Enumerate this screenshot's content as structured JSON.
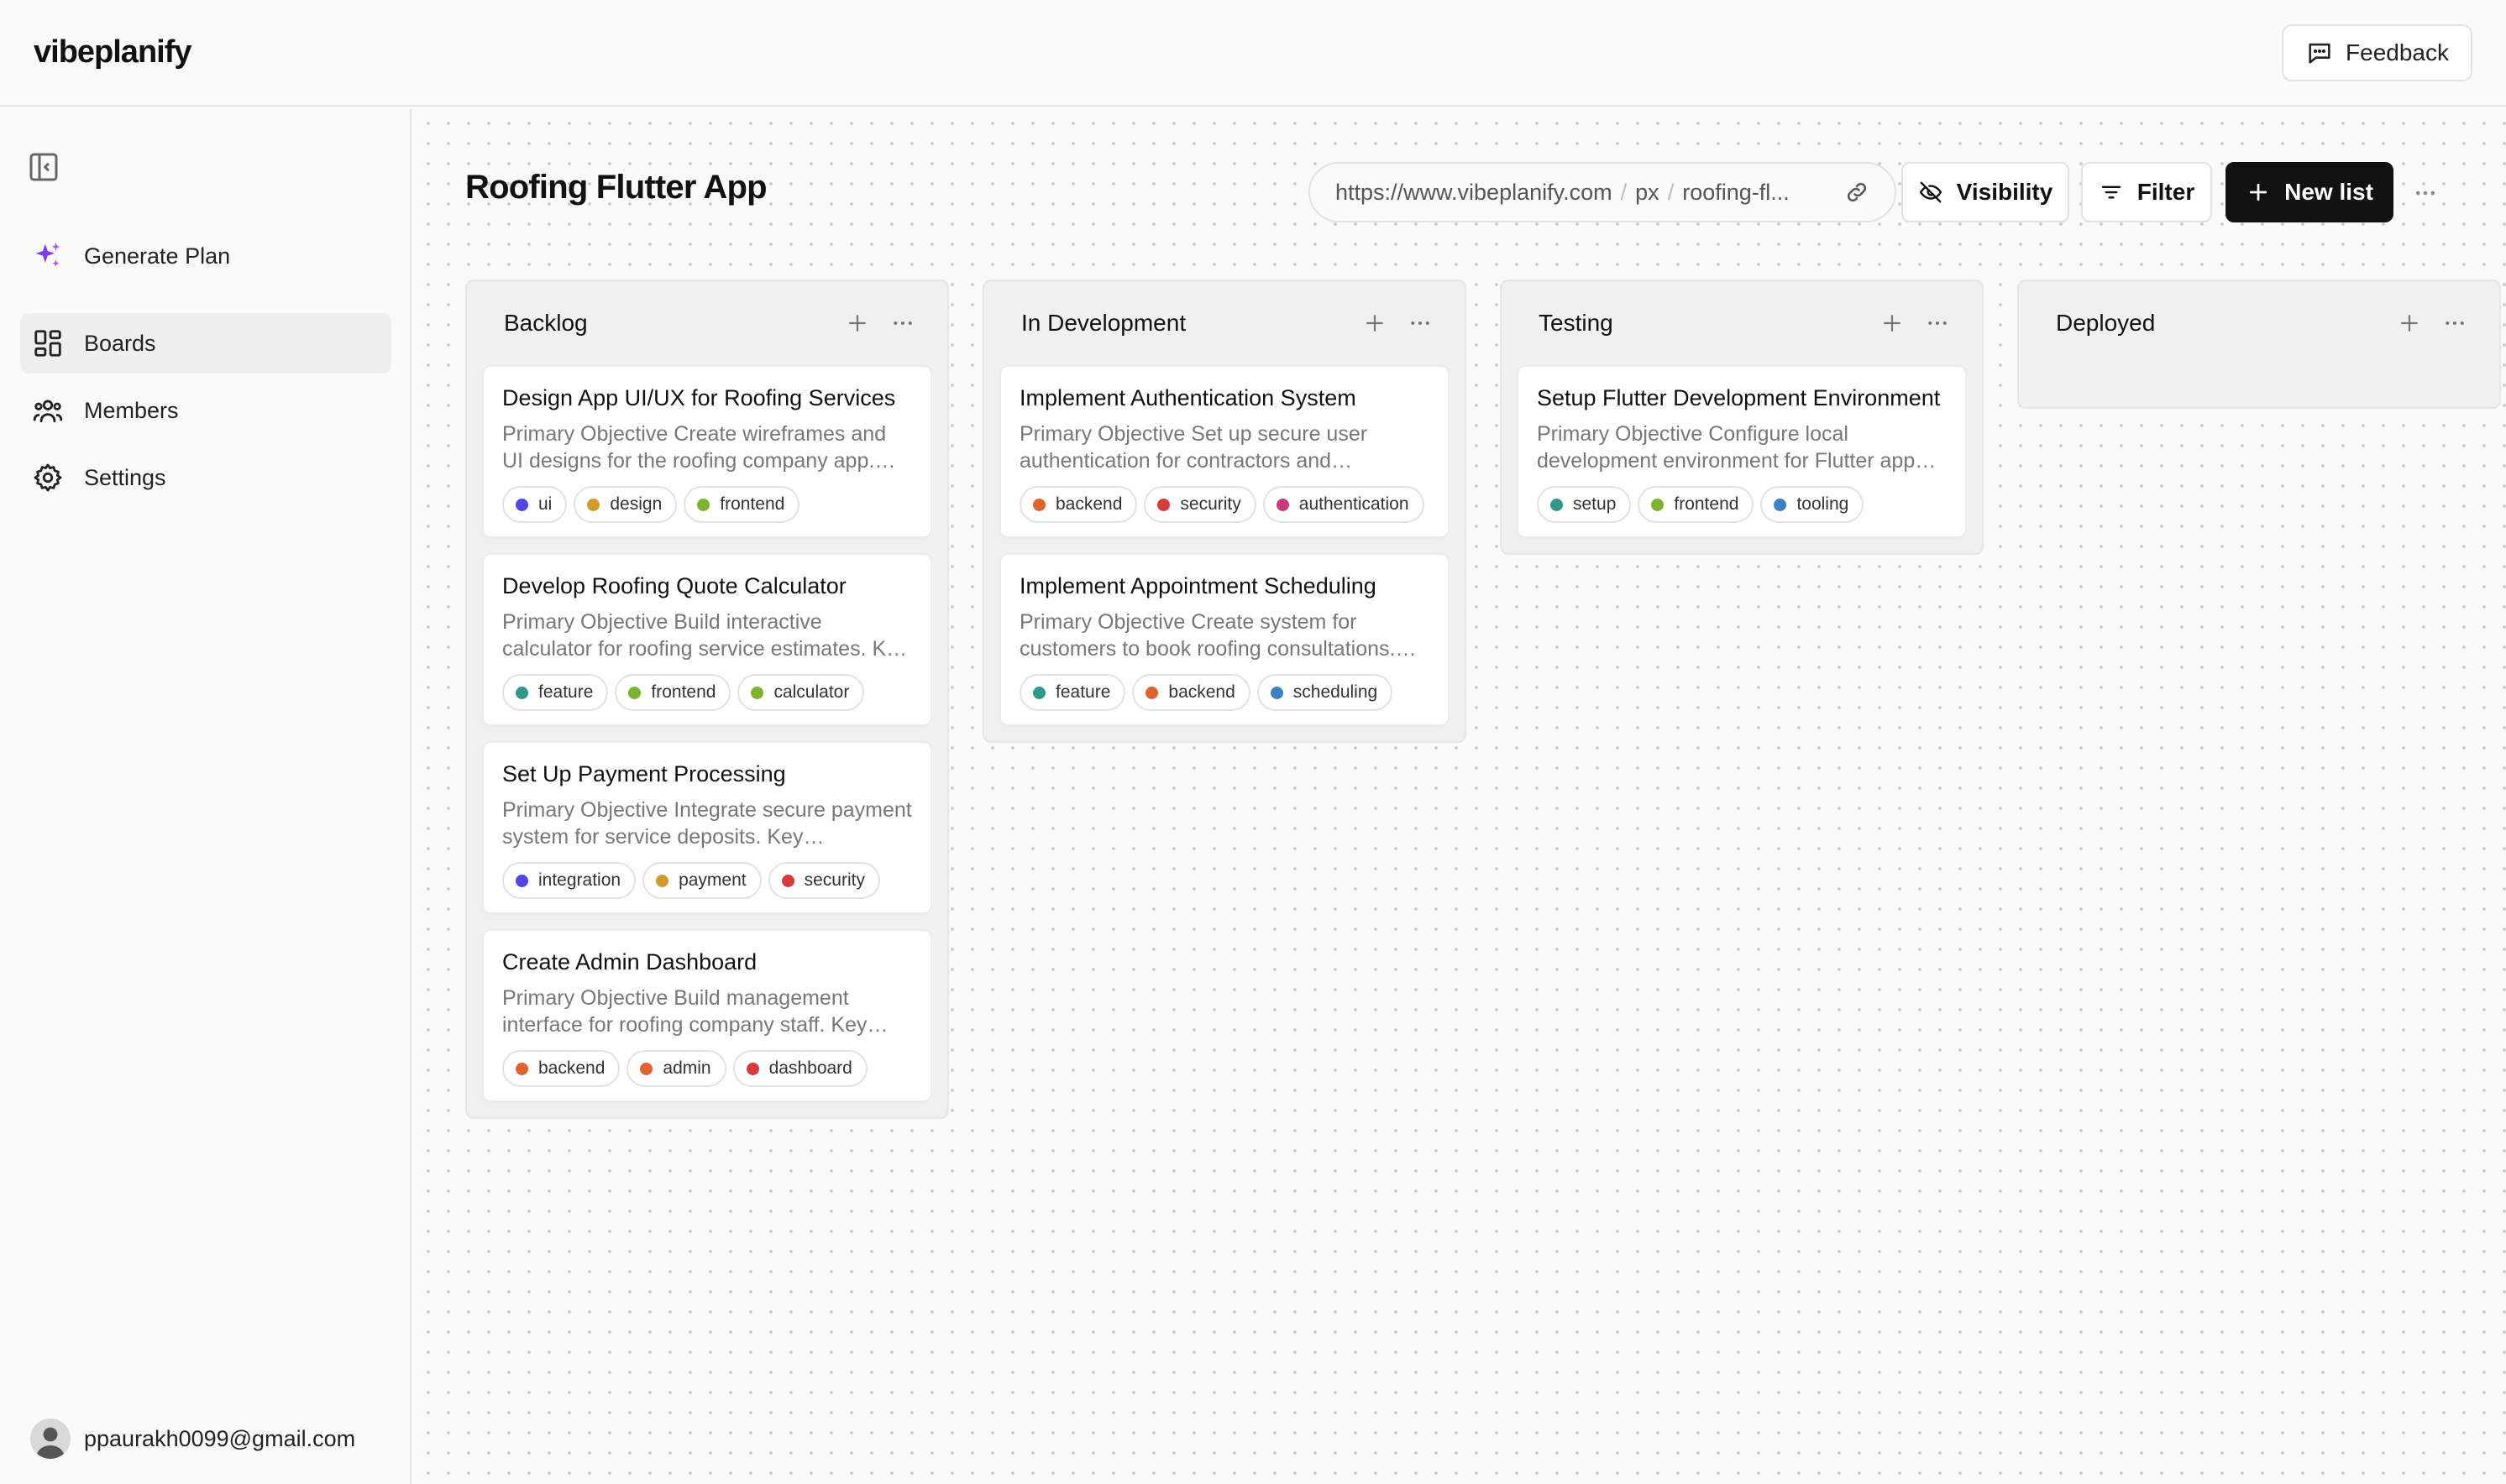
{
  "app": {
    "logo": "vibeplanify",
    "feedback_label": "Feedback"
  },
  "sidebar": {
    "items": [
      {
        "label": "Generate Plan",
        "icon": "sparkles-icon",
        "active": false
      },
      {
        "label": "Boards",
        "icon": "boards-icon",
        "active": true
      },
      {
        "label": "Members",
        "icon": "members-icon",
        "active": false
      },
      {
        "label": "Settings",
        "icon": "gear-icon",
        "active": false
      }
    ],
    "user_email": "ppaurakh0099@gmail.com"
  },
  "board": {
    "title": "Roofing Flutter App",
    "url": {
      "domain": "https://www.vibeplanify.com",
      "segment1": "px",
      "segment2": "roofing-fl..."
    },
    "visibility_label": "Visibility",
    "filter_label": "Filter",
    "new_list_label": "New list"
  },
  "tag_colors": {
    "ui": "#4f46e5",
    "design": "#d19a2a",
    "frontend": "#7cb32f",
    "feature": "#2f9a8a",
    "calculator": "#7cb32f",
    "integration": "#4f46e5",
    "payment": "#d19a2a",
    "security": "#d93a3a",
    "backend": "#e0622c",
    "admin": "#e0622c",
    "dashboard": "#d93a3a",
    "authentication": "#c73a78",
    "scheduling": "#3b82c4",
    "setup": "#2f9a8a",
    "tooling": "#3b82c4"
  },
  "lists": [
    {
      "title": "Backlog",
      "cards": [
        {
          "title": "Design App UI/UX for Roofing Services",
          "desc": "Primary Objective Create wireframes and UI designs for the roofing company app. Key deliverables include screens and flows.",
          "tags": [
            "ui",
            "design",
            "frontend"
          ]
        },
        {
          "title": "Develop Roofing Quote Calculator",
          "desc": "Primary Objective Build interactive calculator for roofing service estimates. Key deliverables include pricing logic.",
          "tags": [
            "feature",
            "frontend",
            "calculator"
          ]
        },
        {
          "title": "Set Up Payment Processing",
          "desc": "Primary Objective Integrate secure payment system for service deposits. Key deliverables include checkout.",
          "tags": [
            "integration",
            "payment",
            "security"
          ]
        },
        {
          "title": "Create Admin Dashboard",
          "desc": "Primary Objective Build management interface for roofing company staff. Key deliverables include reports.",
          "tags": [
            "backend",
            "admin",
            "dashboard"
          ]
        }
      ]
    },
    {
      "title": "In Development",
      "cards": [
        {
          "title": "Implement Authentication System",
          "desc": "Primary Objective Set up secure user authentication for contractors and customers across the platform.",
          "tags": [
            "backend",
            "security",
            "authentication"
          ]
        },
        {
          "title": "Implement Appointment Scheduling",
          "desc": "Primary Objective Create system for customers to book roofing consultations. Key deliverables include calendar.",
          "tags": [
            "feature",
            "backend",
            "scheduling"
          ]
        }
      ]
    },
    {
      "title": "Testing",
      "cards": [
        {
          "title": "Setup Flutter Development Environment",
          "desc": "Primary Objective Configure local development environment for Flutter app builds and tooling.",
          "tags": [
            "setup",
            "frontend",
            "tooling"
          ]
        }
      ]
    },
    {
      "title": "Deployed",
      "cards": []
    }
  ]
}
